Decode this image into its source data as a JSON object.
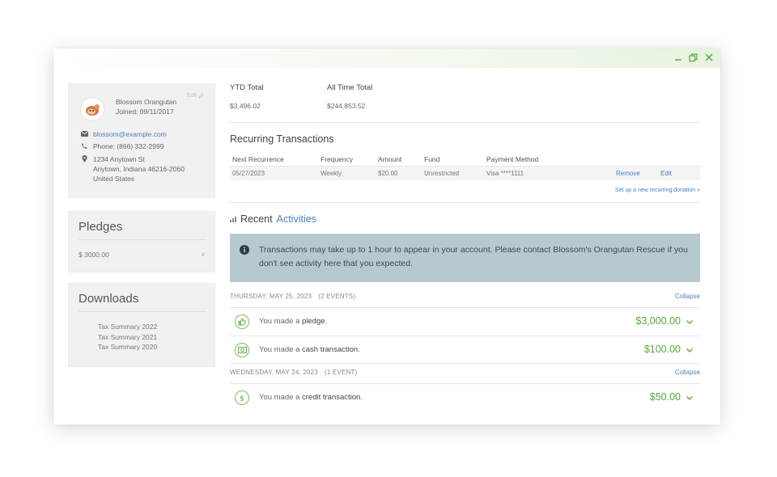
{
  "window": {
    "controls": [
      "minimize-icon",
      "restore-icon",
      "close-icon"
    ],
    "accent_color": "#5aa53d",
    "link_color": "#4a82bd"
  },
  "profile": {
    "name": "Blossom Orangutan",
    "joined": "Joined: 09/11/2017",
    "edit_label": "Edit",
    "email": "blossom@example.com",
    "phone": "Phone: (866) 332-2999",
    "address_line1": "1234 Anytown St",
    "address_line2": "Anytown, Indiana 46216-2060",
    "address_line3": "United States"
  },
  "pledges": {
    "title": "Pledges",
    "items": [
      {
        "amount": "$ 3000.00",
        "remove": "x"
      }
    ]
  },
  "downloads": {
    "title": "Downloads",
    "items": [
      "Tax Summary 2022",
      "Tax Summary 2021",
      "Tax Summary 2020"
    ]
  },
  "totals": {
    "ytd_label": "YTD Total",
    "ytd_value": "$3,496.02",
    "all_label": "All Time Total",
    "all_value": "$244,853.52"
  },
  "recurring": {
    "title": "Recurring Transactions",
    "columns": [
      "Next Recurrence",
      "Frequency",
      "Amount",
      "Fund",
      "Payment Method"
    ],
    "rows": [
      {
        "next": "05/27/2023",
        "frequency": "Weekly",
        "amount": "$20.00",
        "fund": "Unrestricted",
        "payment": "Visa ****1111",
        "remove": "Remove",
        "edit": "Edit"
      }
    ],
    "setup_link": "Set up a new recurring donation »"
  },
  "recent": {
    "title_prefix": "Recent",
    "title_accent": "Activities",
    "notice": "Transactions may take up to 1 hour to appear in your account. Please contact Blossom's Orangutan Rescue if you don't see activity here that you expected.",
    "groups": [
      {
        "date": "THURSDAY, MAY 25, 2023",
        "count": "(2 EVENTS)",
        "collapse": "Collapse",
        "events": [
          {
            "icon": "thumbs-up-icon",
            "prefix": "You made a",
            "keyword": "pledge",
            "suffix": ".",
            "amount": "$3,000.00"
          },
          {
            "icon": "cash-icon",
            "prefix": "You made a",
            "keyword": "cash transaction",
            "suffix": ".",
            "amount": "$100.00"
          }
        ]
      },
      {
        "date": "WEDNESDAY, MAY 24, 2023",
        "count": "(1 EVENT)",
        "collapse": "Collapse",
        "events": [
          {
            "icon": "dollar-icon",
            "prefix": "You made a",
            "keyword": "credit transaction",
            "suffix": ".",
            "amount": "$50.00"
          }
        ]
      }
    ]
  }
}
